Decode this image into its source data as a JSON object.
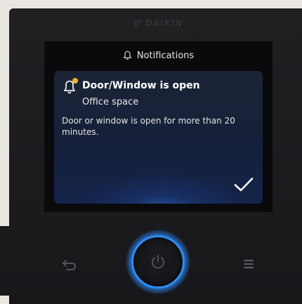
{
  "brand": {
    "name": "DAIKIN"
  },
  "header": {
    "title": "Notifications",
    "icon": "bell-icon"
  },
  "notification": {
    "icon": "bell-alert-icon",
    "badge_color": "#f3b227",
    "title": "Door/Window is open",
    "location": "Office space",
    "message": "Door or window is open for more than 20 minutes.",
    "confirm_icon": "checkmark-icon"
  },
  "controls": {
    "back_icon": "back-arrow-icon",
    "power_icon": "power-icon",
    "menu_icon": "hamburger-menu-icon",
    "accent_color": "#2f8df5"
  }
}
